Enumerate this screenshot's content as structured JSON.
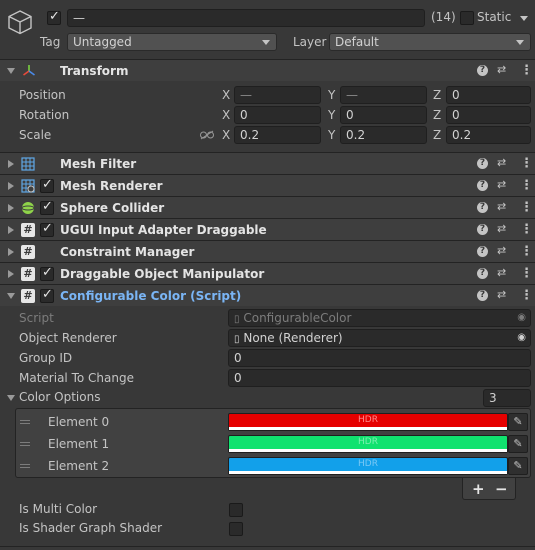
{
  "gameobject": {
    "name": "—",
    "instance_count": "(14)",
    "static_label": "Static",
    "tag_label": "Tag",
    "tag_value": "Untagged",
    "layer_label": "Layer",
    "layer_value": "Default"
  },
  "transform": {
    "title": "Transform",
    "position_label": "Position",
    "rotation_label": "Rotation",
    "scale_label": "Scale",
    "x": "X",
    "y": "Y",
    "z": "Z",
    "position": [
      "—",
      "—",
      "0"
    ],
    "rotation": [
      "0",
      "0",
      "0"
    ],
    "scale": [
      "0.2",
      "0.2",
      "0.2"
    ]
  },
  "components": [
    {
      "title": "Mesh Filter",
      "enabled": null
    },
    {
      "title": "Mesh Renderer",
      "enabled": true
    },
    {
      "title": "Sphere Collider",
      "enabled": true
    },
    {
      "title": "UGUI Input Adapter Draggable",
      "enabled": true
    },
    {
      "title": "Constraint Manager",
      "enabled": null
    },
    {
      "title": "Draggable Object Manipulator",
      "enabled": true
    }
  ],
  "configurable_color": {
    "title": "Configurable Color (Script)",
    "script_label": "Script",
    "script_value": "ConfigurableColor",
    "object_renderer_label": "Object Renderer",
    "object_renderer_value": "None (Renderer)",
    "group_id_label": "Group ID",
    "group_id_value": "0",
    "material_label": "Material To Change",
    "material_value": "0",
    "color_options_label": "Color Options",
    "color_options_count": "3",
    "elements": [
      {
        "label": "Element 0",
        "color": "#e60000"
      },
      {
        "label": "Element 1",
        "color": "#10e26f"
      },
      {
        "label": "Element 2",
        "color": "#12a0ea"
      }
    ],
    "hdr_label": "HDR",
    "add_label": "+",
    "remove_label": "−",
    "multi_color_label": "Is Multi Color",
    "shader_graph_label": "Is Shader Graph Shader"
  },
  "colors": {
    "link_blue": "#7ab5f5"
  }
}
